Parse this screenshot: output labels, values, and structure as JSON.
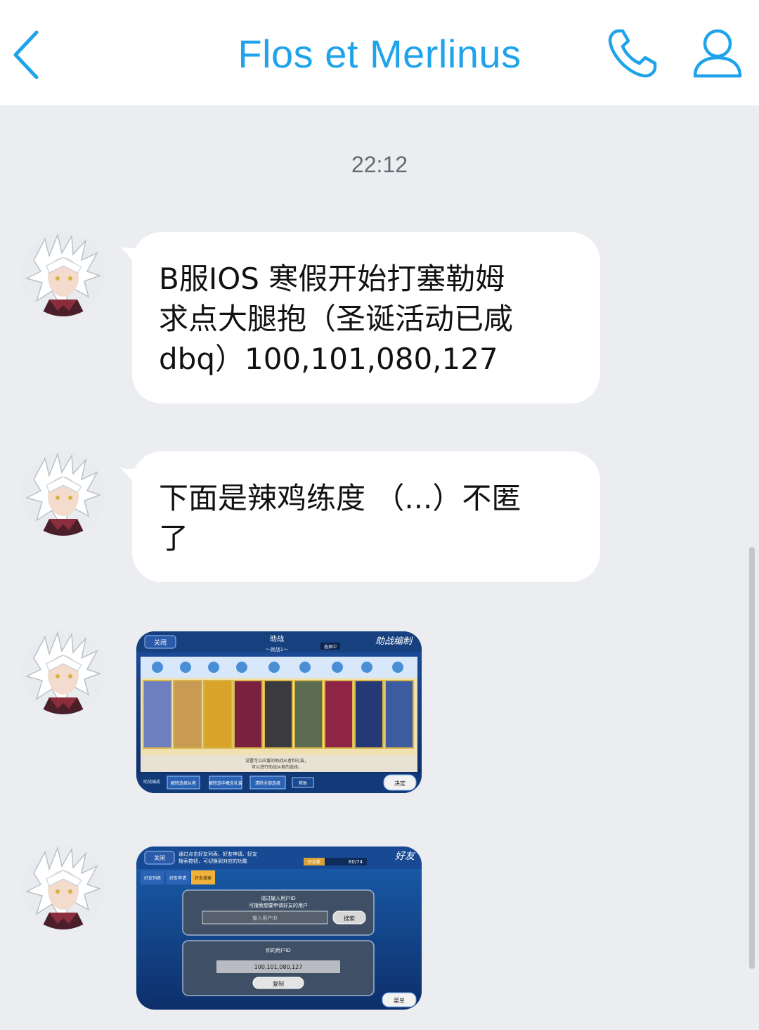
{
  "header": {
    "title": "Flos et Merlinus",
    "back_icon": "chevron-left-icon",
    "call_icon": "phone-icon",
    "profile_icon": "person-icon",
    "accent_color": "#1fa3ea"
  },
  "chat": {
    "timestamp": "22:12",
    "messages": [
      {
        "type": "text",
        "lines": [
          "B服IOS 寒假开始打塞勒姆",
          "求点大腿抱（圣诞活动已咸",
          "dbq）100,101,080,127"
        ]
      },
      {
        "type": "text",
        "lines": [
          "下面是辣鸡练度 （...）不匿",
          "了"
        ]
      },
      {
        "type": "image",
        "game": {
          "close": "关闭",
          "title": "助战",
          "subtitle": "～就战1～",
          "badge": "选择中",
          "right_title": "助战编制",
          "notice_1": "设置可以应援的助战从者和礼装，",
          "notice_2": "可以进行助战从者的选择。",
          "btn_1": "解除选择从者",
          "btn_2": "解除选中概念礼装",
          "btn_3": "清除全部选择",
          "btn_4": "帮助",
          "confirm": "决定",
          "left_label": "助战编成"
        }
      },
      {
        "type": "image",
        "game": {
          "close": "关闭",
          "hint_1": "通过点击好友列表、好友申请、好友",
          "hint_2": "搜索按钮，可切换到对应的功能",
          "friend_count_label": "好友数",
          "friend_count": "60/74",
          "tab_1": "好友列表",
          "tab_2": "好友申请",
          "tab_3": "好友搜索",
          "search_hint_1": "请过输入用户ID",
          "search_hint_2": "可搜索想要申请好友的用户",
          "search_placeholder": "输入用户ID",
          "search_button": "搜索",
          "your_id_label": "你的用户ID",
          "your_id": "100,101,080,127",
          "copy_button": "复制",
          "menu_button": "菜单",
          "right_title": "好友"
        }
      }
    ]
  }
}
